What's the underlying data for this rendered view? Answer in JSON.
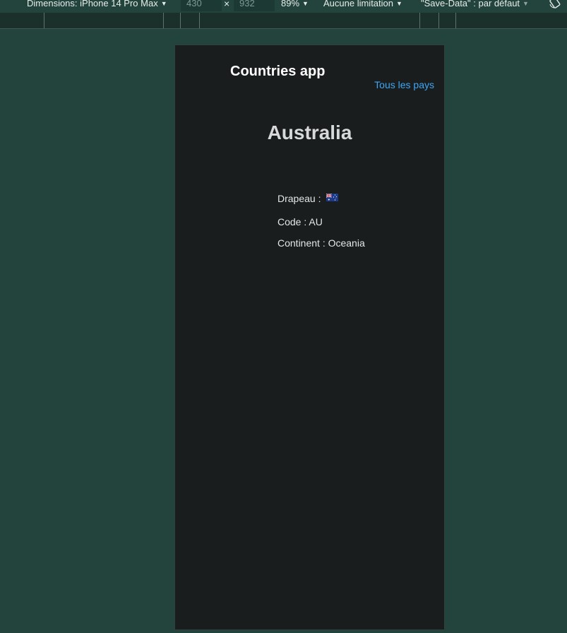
{
  "devtools": {
    "dimensions_label": "Dimensions: iPhone 14 Pro Max",
    "width_value": "430",
    "times_symbol": "×",
    "height_value": "932",
    "zoom_label": "89%",
    "throttling_label": "Aucune limitation",
    "save_data_label": "\"Save-Data\" : par défaut",
    "caret_symbol": "▼"
  },
  "app": {
    "title": "Countries app",
    "nav_link": "Tous les pays"
  },
  "country": {
    "name": "Australia",
    "flag_label": "Drapeau :",
    "flag_icon": "australia-flag",
    "code_text": "Code : AU",
    "continent_text": "Continent : Oceania"
  },
  "colors": {
    "backdrop": "#23443c",
    "device_bg": "#1a1d1e",
    "link": "#3fa6f5"
  }
}
